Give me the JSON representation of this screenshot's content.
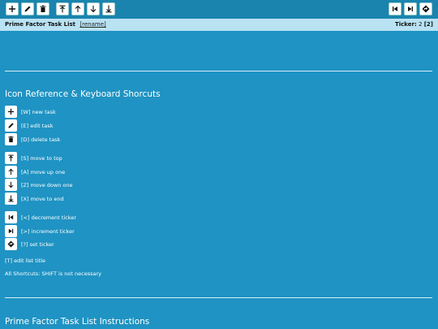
{
  "toolbar": {
    "left_buttons": [
      {
        "icon": "plus-icon",
        "glyph": "+"
      },
      {
        "icon": "pencil-icon"
      },
      {
        "icon": "trash-icon"
      },
      {
        "icon": "move-top-icon"
      },
      {
        "icon": "arrow-up-icon"
      },
      {
        "icon": "arrow-down-icon"
      },
      {
        "icon": "move-end-icon"
      }
    ],
    "right_buttons": [
      {
        "icon": "skip-back-icon"
      },
      {
        "icon": "skip-forward-icon"
      },
      {
        "icon": "set-ticker-icon"
      }
    ]
  },
  "titlebar": {
    "title": "Prime Factor Task List",
    "rename": "[rename]",
    "ticker_label": "Ticker:",
    "ticker_value": "2",
    "ticker_bracket": "[2]"
  },
  "reference": {
    "heading": "Icon Reference & Keyboard Shorcuts",
    "items": [
      {
        "icon": "plus-icon",
        "label": "[W] new task"
      },
      {
        "icon": "pencil-icon",
        "label": "[E] edit task"
      },
      {
        "icon": "trash-icon",
        "label": "[D] delete task"
      },
      {
        "icon": "move-top-icon",
        "label": "[S] move to top"
      },
      {
        "icon": "arrow-up-icon",
        "label": "[A] move up one"
      },
      {
        "icon": "arrow-down-icon",
        "label": "[Z] move down one"
      },
      {
        "icon": "move-end-icon",
        "label": "[X] move to end"
      },
      {
        "icon": "skip-back-icon",
        "label": "[<] decrement ticker"
      },
      {
        "icon": "skip-forward-icon",
        "label": "[>] increment ticker"
      },
      {
        "icon": "set-ticker-icon",
        "label": "[?] set ticker"
      }
    ],
    "edit_title": "[T] edit list title",
    "all_shortcuts": "All Shortcuts: SHIFT is not necessary"
  },
  "instructions": {
    "heading": "Prime Factor Task List Instructions"
  },
  "colors": {
    "background": "#1f93c3",
    "toolbar": "#1a84ae",
    "titlebar": "#b9e2f3"
  }
}
